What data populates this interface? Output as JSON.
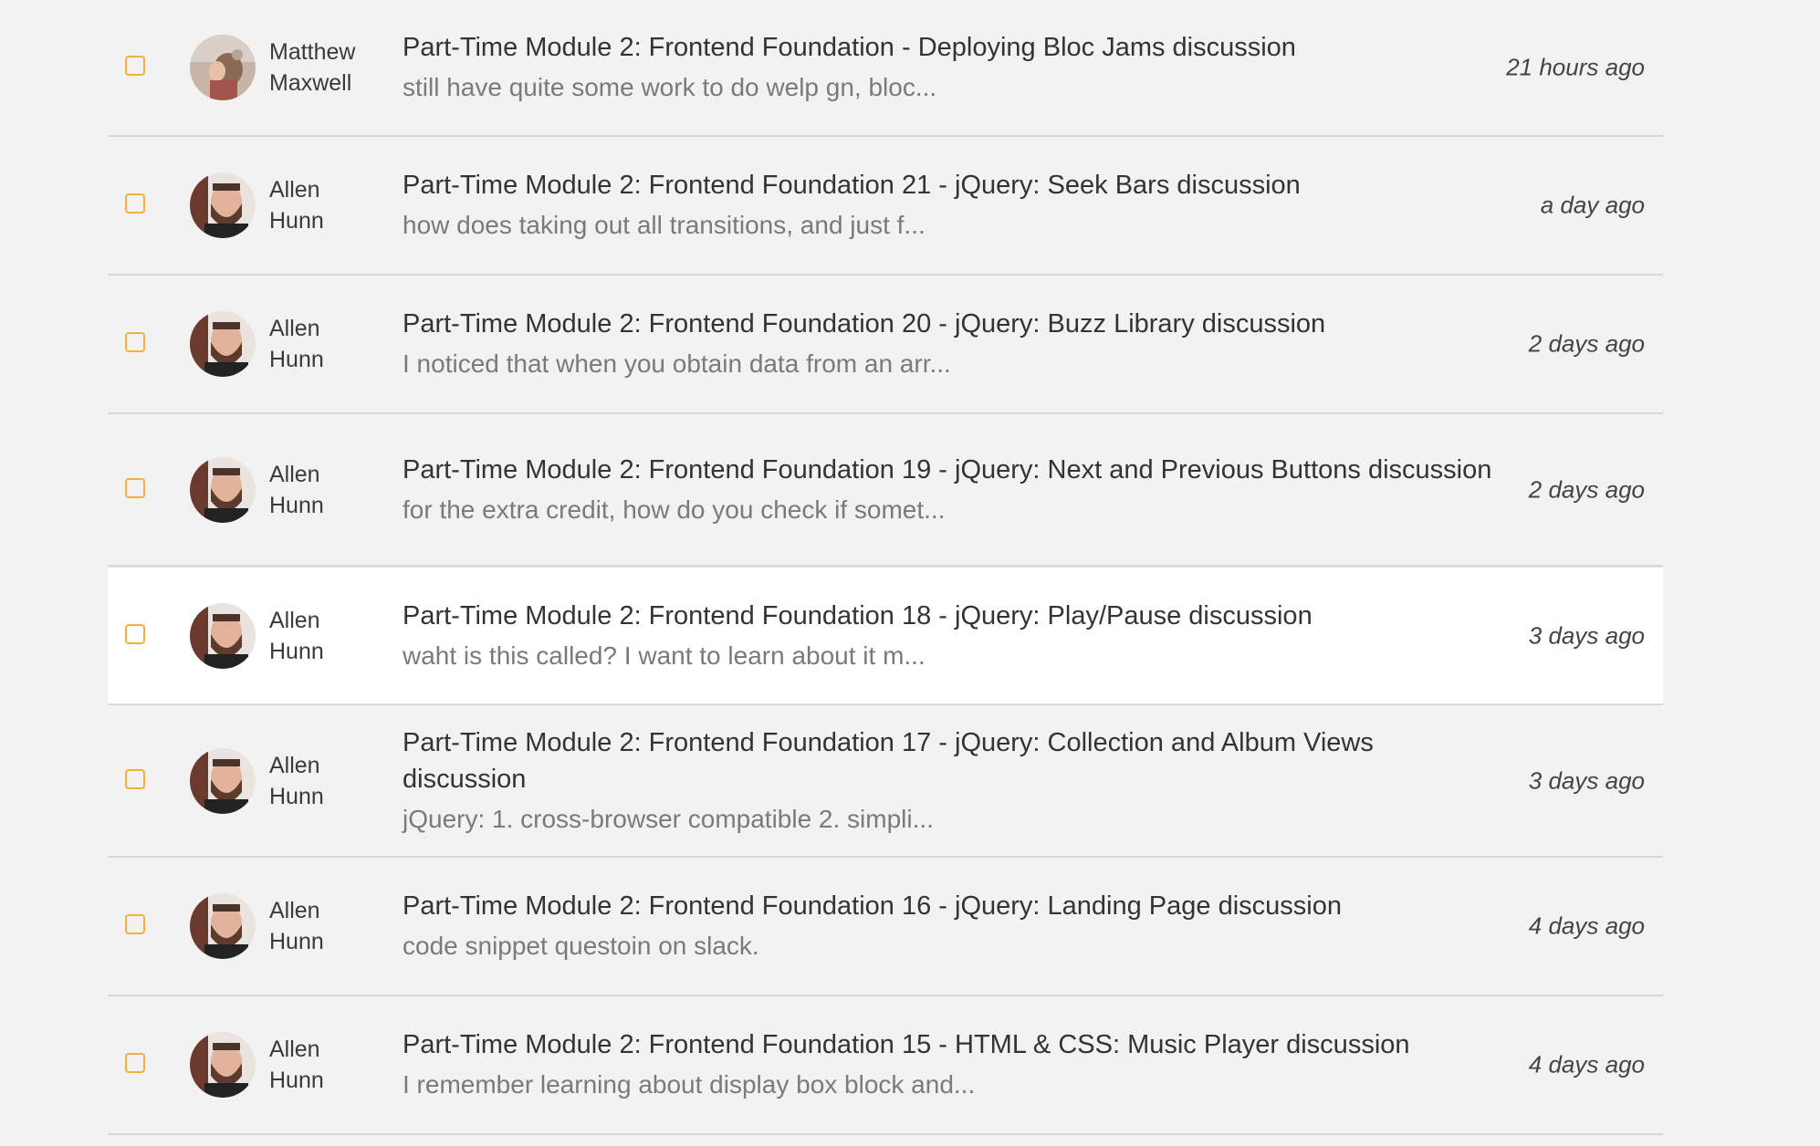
{
  "discussions": [
    {
      "author_first": "Matthew",
      "author_last": "Maxwell",
      "avatar": "matthew-avatar",
      "title": "Part-Time Module 2: Frontend Foundation - Deploying Bloc Jams discussion",
      "excerpt": "still have quite some work to do welp gn, bloc...",
      "time": "21 hours ago"
    },
    {
      "author_first": "Allen",
      "author_last": "Hunn",
      "avatar": "allen-avatar",
      "title": "Part-Time Module 2: Frontend Foundation 21 - jQuery: Seek Bars discussion",
      "excerpt": "how does taking out all transitions, and just f...",
      "time": "a day ago"
    },
    {
      "author_first": "Allen",
      "author_last": "Hunn",
      "avatar": "allen-avatar",
      "title": "Part-Time Module 2: Frontend Foundation 20 - jQuery: Buzz Library discussion",
      "excerpt": "I noticed that when you obtain data from an arr...",
      "time": "2 days ago"
    },
    {
      "author_first": "Allen",
      "author_last": "Hunn",
      "avatar": "allen-avatar",
      "title": "Part-Time Module 2: Frontend Foundation 19 - jQuery: Next and Previous Buttons discussion",
      "excerpt": "for the extra credit, how do you check if somet...",
      "time": "2 days ago"
    },
    {
      "author_first": "Allen",
      "author_last": "Hunn",
      "avatar": "allen-avatar",
      "title": "Part-Time Module 2: Frontend Foundation 18 - jQuery: Play/Pause discussion",
      "excerpt": "waht is this called? I want to learn about it m...",
      "time": "3 days ago"
    },
    {
      "author_first": "Allen",
      "author_last": "Hunn",
      "avatar": "allen-avatar",
      "title": "Part-Time Module 2: Frontend Foundation 17 - jQuery: Collection and Album Views discussion",
      "excerpt": "jQuery: 1. cross-browser compatible 2. simpli...",
      "time": "3 days ago"
    },
    {
      "author_first": "Allen",
      "author_last": "Hunn",
      "avatar": "allen-avatar",
      "title": "Part-Time Module 2: Frontend Foundation 16 - jQuery: Landing Page discussion",
      "excerpt": "code snippet questoin on slack.",
      "time": "4 days ago"
    },
    {
      "author_first": "Allen",
      "author_last": "Hunn",
      "avatar": "allen-avatar",
      "title": "Part-Time Module 2: Frontend Foundation 15 - HTML & CSS: Music Player discussion",
      "excerpt": "I remember learning about display box block and...",
      "time": "4 days ago"
    }
  ],
  "colors": {
    "page_background": "#f2f2f2",
    "highlight_row": "#ffffff",
    "checkbox_accent": "#f2b13a",
    "divider": "#d8d8d8"
  }
}
